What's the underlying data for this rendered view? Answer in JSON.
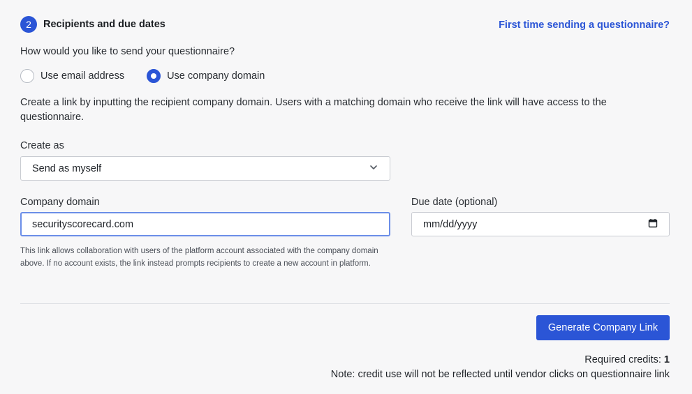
{
  "section": {
    "step_number": "2",
    "title": "Recipients and due dates",
    "help_link": "First time sending a questionnaire?"
  },
  "send_method": {
    "question": "How would you like to send your questionnaire?",
    "options": [
      {
        "label": "Use email address",
        "selected": false
      },
      {
        "label": "Use company domain",
        "selected": true
      }
    ]
  },
  "description": "Create a link by inputting the recipient company domain. Users with a matching domain who receive the link will have access to the questionnaire.",
  "create_as": {
    "label": "Create as",
    "value": "Send as myself"
  },
  "company_domain": {
    "label": "Company domain",
    "value": "securityscorecard.com",
    "hint": "This link allows collaboration with users of the platform account associated with the company domain above. If no account exists, the link instead prompts recipients to create a new account in platform."
  },
  "due_date": {
    "label": "Due date (optional)",
    "placeholder": "mm/dd/yyyy"
  },
  "actions": {
    "generate_label": "Generate Company Link"
  },
  "footer": {
    "credits_label": "Required credits: ",
    "credits_value": "1",
    "note": "Note: credit use will not be reflected until vendor clicks on questionnaire link"
  },
  "colors": {
    "accent": "#2b55d6",
    "background": "#f7f7f8"
  }
}
